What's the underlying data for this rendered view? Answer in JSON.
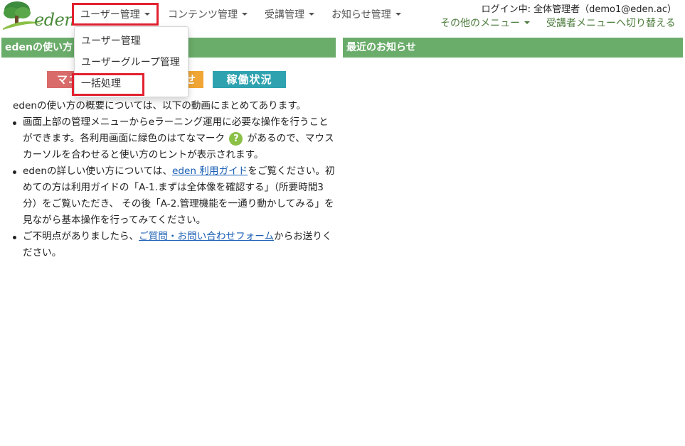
{
  "logo": {
    "text": "eden"
  },
  "nav": {
    "user_mgmt": "ユーザー管理",
    "content_mgmt": "コンテンツ管理",
    "course_mgmt": "受講管理",
    "news_mgmt": "お知らせ管理",
    "other_menu": "その他のメニュー",
    "switch_menu": "受講者メニューへ切り替える"
  },
  "login": {
    "text": "ログイン中: 全体管理者（demo1@eden.ac）"
  },
  "dropdown": {
    "items": [
      "ユーザー管理",
      "ユーザーグループ管理",
      "一括処理"
    ]
  },
  "left_panel": {
    "title": "edenの使い方"
  },
  "right_panel": {
    "title": "最近のお知らせ"
  },
  "buttons": {
    "manual": "マニ",
    "contact": "せ",
    "status": "稼働状況"
  },
  "content": {
    "intro": "edenの使い方の概要については、以下の動画にまとめてあります。",
    "b1_a": "画面上部の管理メニューからeラーニング運用に必要な操作を行うことができます。各利用画面に緑色のはてなマーク",
    "b1_icon": "?",
    "b1_b": "があるので、マウスカーソルを合わせると使い方のヒントが表示されます。",
    "b2_a": "edenの詳しい使い方については、",
    "b2_link": "eden 利用ガイド",
    "b2_b": "をご覧ください。初めての方は利用ガイドの「A-1.まずは全体像を確認する」（所要時間3分）をご覧いただき、 その後「A-2.管理機能を一通り動かしてみる」を見ながら基本操作を行ってみてください。",
    "b3_a": "ご不明点がありましたら、",
    "b3_link": "ご質問・お問い合わせフォーム",
    "b3_b": "からお送りください。"
  },
  "colors": {
    "panel_header": "#6aac6a",
    "highlight": "#e2212f",
    "link": "#1a5fb4",
    "help_icon": "#8ac045"
  }
}
